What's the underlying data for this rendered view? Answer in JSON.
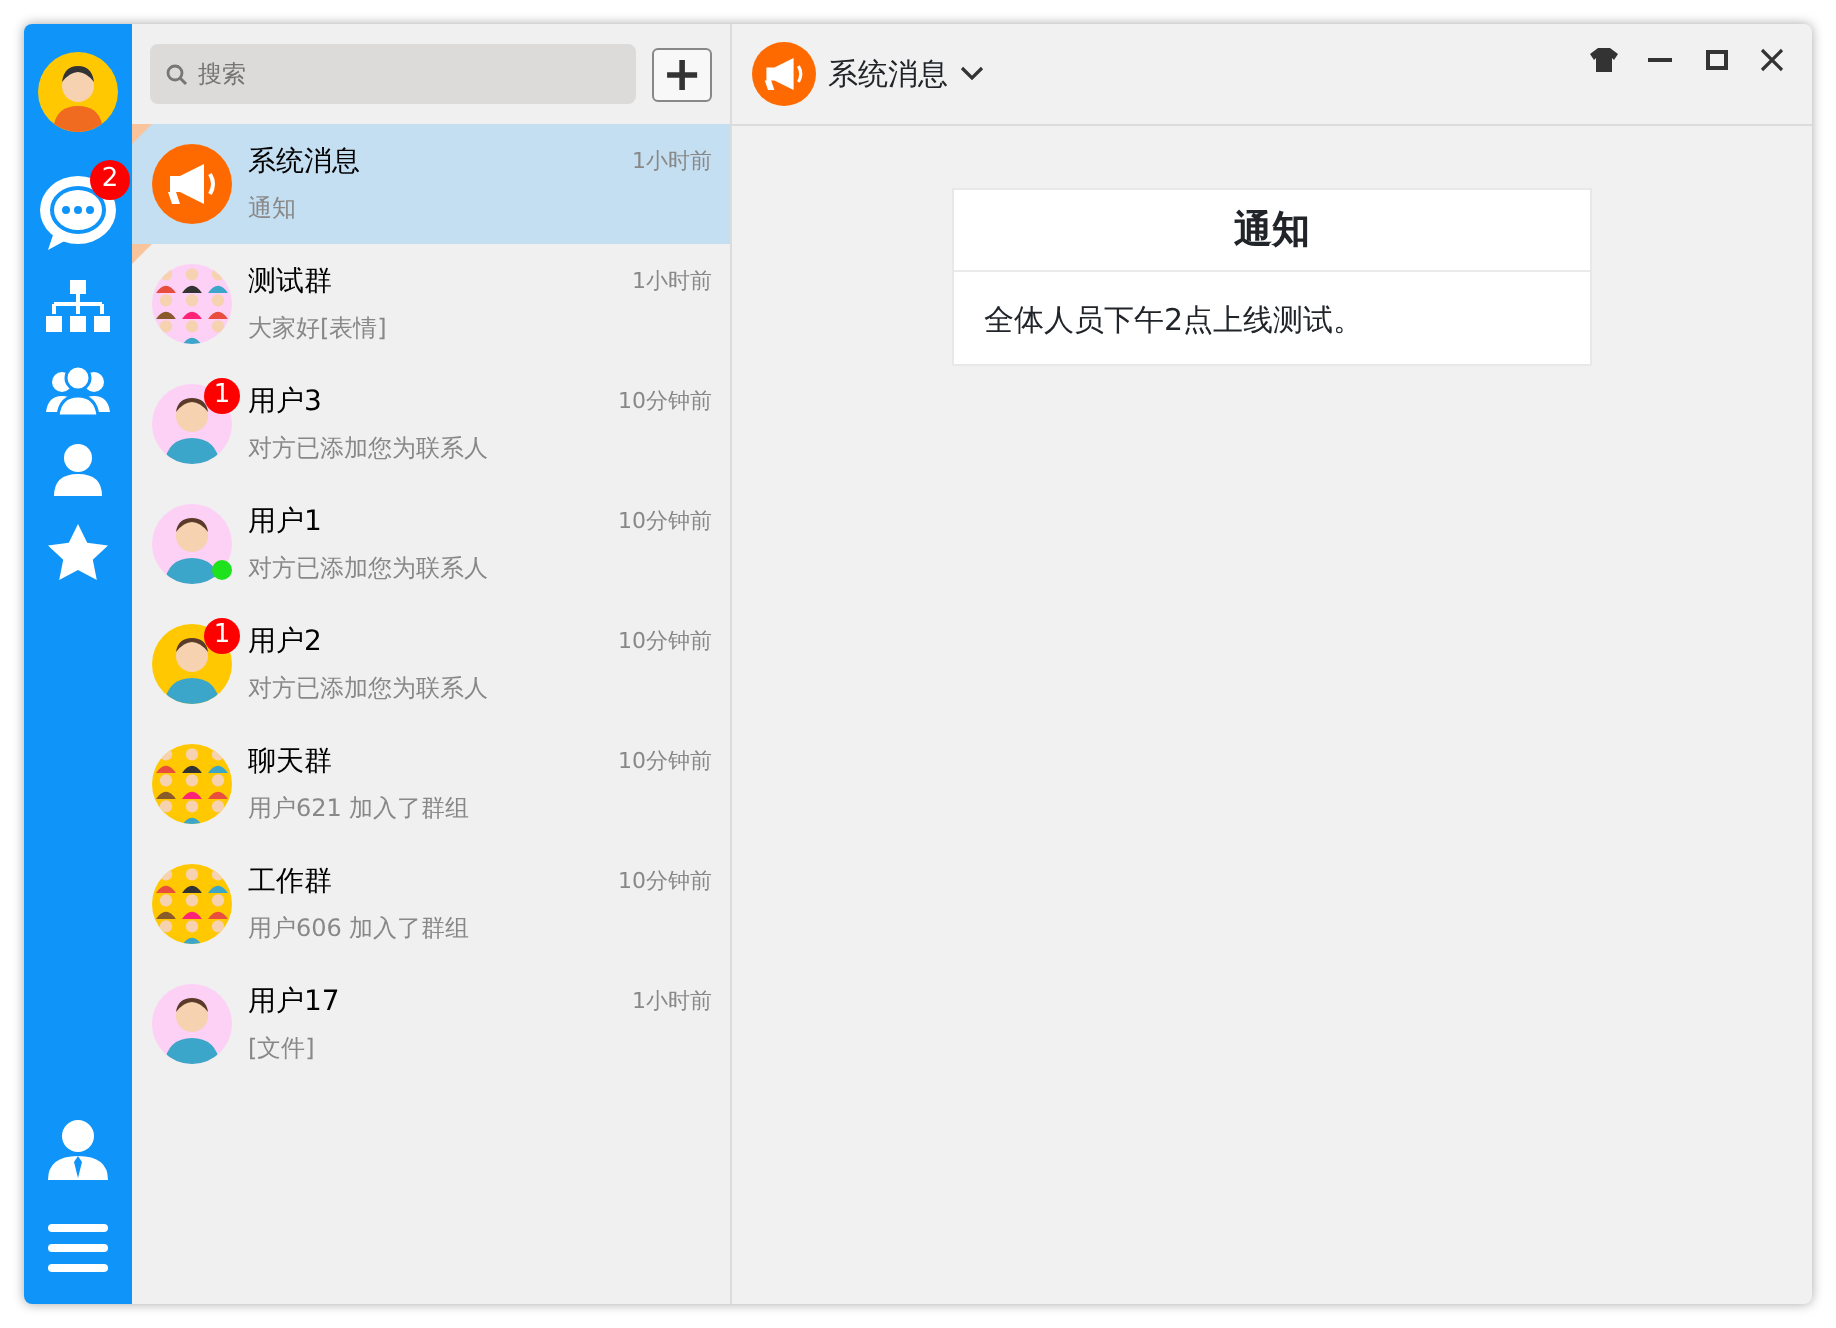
{
  "rail": {
    "chat_badge": "2"
  },
  "search": {
    "placeholder": "搜索"
  },
  "add_button": "+",
  "conversations": [
    {
      "name": "系统消息",
      "time": "1小时前",
      "preview": "通知",
      "selected": true,
      "pinned": true,
      "kind": "megaphone",
      "color": "#ff6a00"
    },
    {
      "name": "测试群",
      "time": "1小时前",
      "preview": "大家好[表情]",
      "selected": false,
      "pinned": true,
      "kind": "group",
      "color": "#fdd0f5"
    },
    {
      "name": "用户3",
      "time": "10分钟前",
      "preview": "对方已添加您为联系人",
      "selected": false,
      "pinned": false,
      "kind": "person",
      "color": "#fdd0f5",
      "badge": "1",
      "online": false
    },
    {
      "name": "用户1",
      "time": "10分钟前",
      "preview": "对方已添加您为联系人",
      "selected": false,
      "pinned": false,
      "kind": "person",
      "color": "#fdd0f5",
      "online": true
    },
    {
      "name": "用户2",
      "time": "10分钟前",
      "preview": "对方已添加您为联系人",
      "selected": false,
      "pinned": false,
      "kind": "person",
      "color": "#ffc800",
      "badge": "1",
      "online": false
    },
    {
      "name": "聊天群",
      "time": "10分钟前",
      "preview": "用户621 加入了群组",
      "selected": false,
      "pinned": false,
      "kind": "group",
      "color": "#ffc800"
    },
    {
      "name": "工作群",
      "time": "10分钟前",
      "preview": "用户606 加入了群组",
      "selected": false,
      "pinned": false,
      "kind": "group",
      "color": "#ffc800"
    },
    {
      "name": "用户17",
      "time": "1小时前",
      "preview": "[文件]",
      "selected": false,
      "pinned": false,
      "kind": "person",
      "color": "#fdd0f5",
      "online": false
    }
  ],
  "header": {
    "title": "系统消息"
  },
  "notice": {
    "title": "通知",
    "body": "全体人员下午2点上线测试。"
  }
}
